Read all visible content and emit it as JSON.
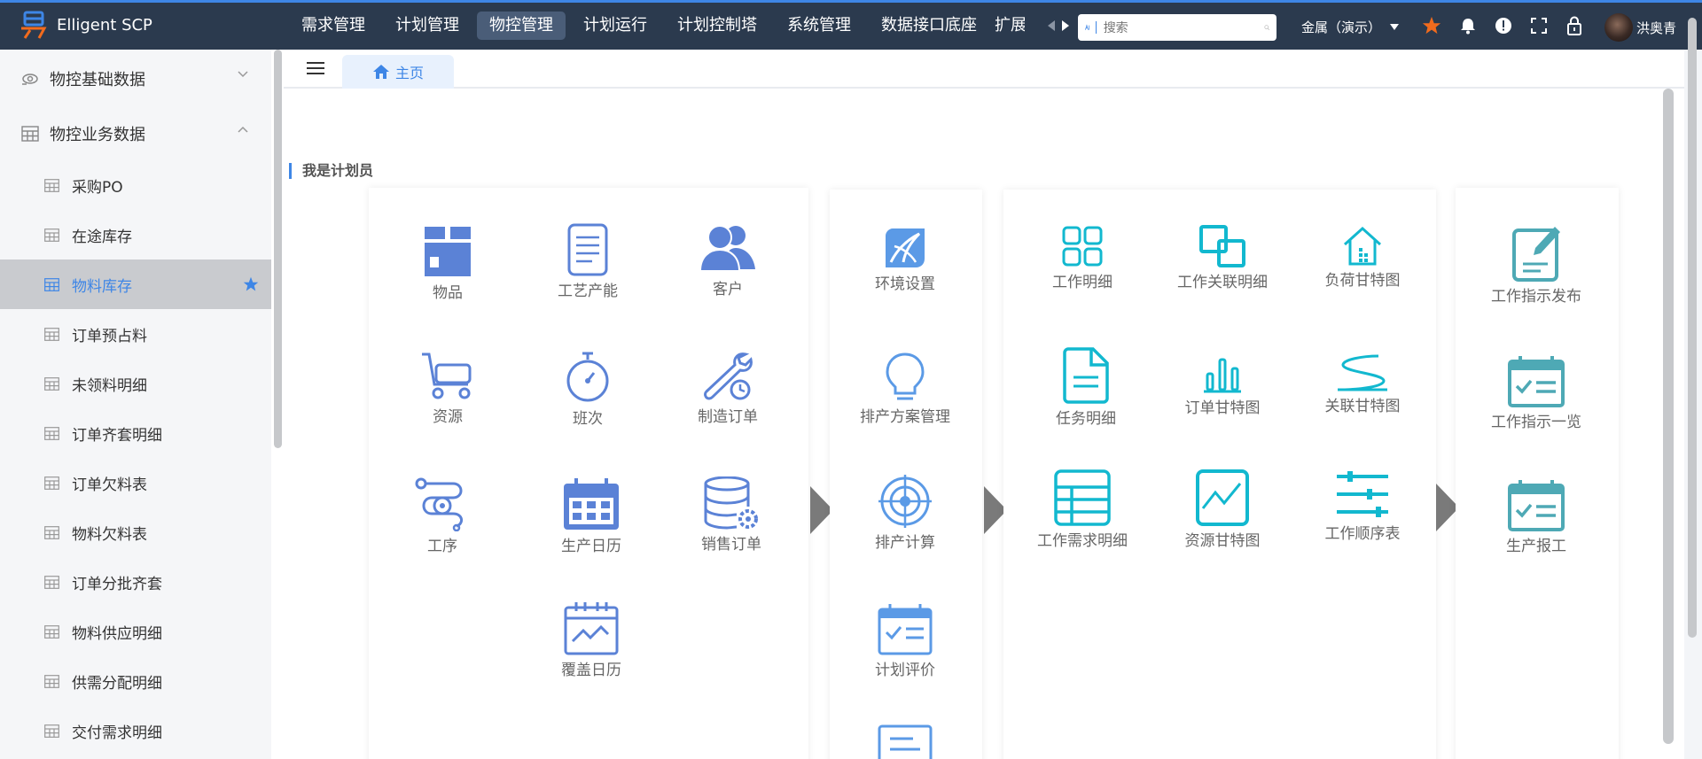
{
  "app": {
    "title": "Elligent SCP"
  },
  "nav": {
    "items": [
      "需求管理",
      "计划管理",
      "物控管理",
      "计划运行",
      "计划控制塔",
      "系统管理",
      "数据接口底座",
      "扩展"
    ],
    "active_index": 2
  },
  "search": {
    "placeholder": "搜索"
  },
  "tenant": {
    "label": "金属（演示）"
  },
  "user": {
    "name": "洪奥青"
  },
  "sidebar": {
    "groups": [
      {
        "label": "物控基础数据",
        "expanded": false
      },
      {
        "label": "物控业务数据",
        "expanded": true
      }
    ],
    "items": [
      "采购PO",
      "在途库存",
      "物料库存",
      "订单预占料",
      "未领料明细",
      "订单齐套明细",
      "订单欠料表",
      "物料欠料表",
      "订单分批齐套",
      "物料供应明细",
      "供需分配明细",
      "交付需求明细"
    ],
    "active_index": 2
  },
  "tabs": {
    "home": "主页"
  },
  "section": {
    "title": "我是计划员"
  },
  "panels": {
    "p1": [
      "物品",
      "工艺产能",
      "客户",
      "资源",
      "班次",
      "制造订单",
      "工序",
      "生产日历",
      "销售订单",
      "覆盖日历"
    ],
    "p2": [
      "环境设置",
      "排产方案管理",
      "排产计算",
      "计划评价"
    ],
    "p3": [
      "工作明细",
      "工作关联明细",
      "负荷甘特图",
      "任务明细",
      "订单甘特图",
      "关联甘特图",
      "工作需求明细",
      "资源甘特图",
      "工作顺序表"
    ],
    "p4": [
      "工作指示发布",
      "工作指示一览",
      "生产报工"
    ]
  },
  "colors": {
    "accent": "#3e86e6",
    "topbar": "#2b3a4e",
    "icon_blue": "#5b82d6",
    "icon_cyan": "#12b8cf",
    "icon_teal": "#4ea9b5",
    "star": "#f26b1d"
  }
}
